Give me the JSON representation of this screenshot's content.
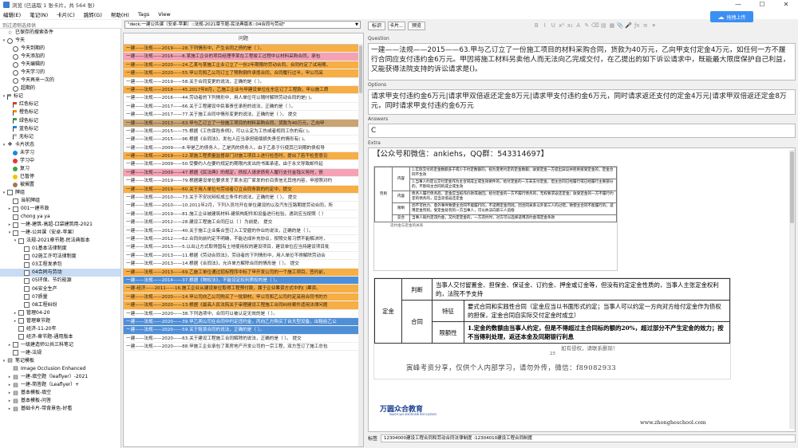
{
  "window": {
    "title": "浏览 (已选取 1 张卡片，共 564 张)",
    "minimize": "—",
    "maximize": "☐",
    "close": "✕"
  },
  "menu": [
    "编辑(E)",
    "笔记(N)",
    "卡片(C)",
    "跳转(G)",
    "帮助(H)",
    "Tags",
    "View"
  ],
  "cloud_button": "拖拽上传",
  "sidebar": {
    "filter_placeholder": "到过滤侧选择供",
    "items": [
      {
        "label": "已保存的搜索条件",
        "icon": "star-icon",
        "indent": 0,
        "exp": ""
      },
      {
        "label": "今天",
        "icon": "clock-icon",
        "indent": 0,
        "exp": "v"
      },
      {
        "label": "今天到期的",
        "icon": "clock-icon",
        "indent": 1,
        "exp": ""
      },
      {
        "label": "今天添加的",
        "icon": "clock-icon",
        "indent": 1,
        "exp": ""
      },
      {
        "label": "今天编辑的",
        "icon": "clock-icon",
        "indent": 1,
        "exp": ""
      },
      {
        "label": "今天学习的",
        "icon": "clock-icon",
        "indent": 1,
        "exp": ""
      },
      {
        "label": "今天再来一次的",
        "icon": "clock-icon",
        "indent": 1,
        "exp": ""
      },
      {
        "label": "超期的",
        "icon": "clock-icon",
        "indent": 1,
        "exp": ""
      },
      {
        "label": "标记",
        "icon": "flag-icon",
        "indent": 0,
        "exp": "v",
        "color": "#888"
      },
      {
        "label": "红色标记",
        "icon": "flag-icon",
        "indent": 1,
        "exp": "",
        "color": "#e53935"
      },
      {
        "label": "橙色标记",
        "icon": "flag-icon",
        "indent": 1,
        "exp": "",
        "color": "#fb8c00"
      },
      {
        "label": "绿色标记",
        "icon": "flag-icon",
        "indent": 1,
        "exp": "",
        "color": "#43a047"
      },
      {
        "label": "蓝色标记",
        "icon": "flag-icon",
        "indent": 1,
        "exp": "",
        "color": "#1e88e5"
      },
      {
        "label": "无标记",
        "icon": "flag-icon",
        "indent": 1,
        "exp": "",
        "color": "#bbb"
      },
      {
        "label": "卡片状态",
        "icon": "status-icon",
        "indent": 0,
        "exp": "v"
      },
      {
        "label": "未学习",
        "icon": "dot-icon",
        "indent": 1,
        "exp": "",
        "color": "#1e88e5"
      },
      {
        "label": "学习中",
        "icon": "dot-icon",
        "indent": 1,
        "exp": "",
        "color": "#e53935"
      },
      {
        "label": "复习",
        "icon": "dot-icon",
        "indent": 1,
        "exp": "",
        "color": "#43a047"
      },
      {
        "label": "已暂停",
        "icon": "dot-icon",
        "indent": 1,
        "exp": "",
        "color": "#f6c200"
      },
      {
        "label": "被搁置",
        "icon": "dot-icon",
        "indent": 1,
        "exp": "",
        "color": "#9e7b4f"
      },
      {
        "label": "牌组",
        "icon": "deck-icon",
        "indent": 0,
        "exp": "v"
      },
      {
        "label": "当前牌组",
        "icon": "deck-icon",
        "indent": 1,
        "exp": ""
      },
      {
        "label": "001一建市政",
        "icon": "deck-icon",
        "indent": 1,
        "exp": ">"
      },
      {
        "label": "chong ya ya",
        "icon": "deck-icon",
        "indent": 1,
        "exp": ""
      },
      {
        "label": "一建-建筑-高超-口袋建筑用-2021",
        "icon": "deck-icon",
        "indent": 1,
        "exp": ">"
      },
      {
        "label": "一建-公共课（安卓-苹果）",
        "icon": "deck-icon",
        "indent": 1,
        "exp": "v"
      },
      {
        "label": "法规-2021章节题-民法典版本",
        "icon": "deck-icon",
        "indent": 2,
        "exp": "v"
      },
      {
        "label": "01基本法律制度",
        "icon": "deck-icon",
        "indent": 3,
        "exp": ""
      },
      {
        "label": "02施工许可法律制度",
        "icon": "deck-icon",
        "indent": 3,
        "exp": ""
      },
      {
        "label": "03工程发承包",
        "icon": "deck-icon",
        "indent": 3,
        "exp": ""
      },
      {
        "label": "04合同与劳动",
        "icon": "deck-icon",
        "indent": 3,
        "exp": "",
        "sel": true
      },
      {
        "label": "05环保、节约能源",
        "icon": "deck-icon",
        "indent": 3,
        "exp": ""
      },
      {
        "label": "06安全生产",
        "icon": "deck-icon",
        "indent": 3,
        "exp": ""
      },
      {
        "label": "07质量",
        "icon": "deck-icon",
        "indent": 3,
        "exp": ""
      },
      {
        "label": "08工程纠纷",
        "icon": "deck-icon",
        "indent": 3,
        "exp": ""
      },
      {
        "label": "管理04-20",
        "icon": "deck-icon",
        "indent": 2,
        "exp": ">"
      },
      {
        "label": "管理章节题",
        "icon": "deck-icon",
        "indent": 2,
        "exp": ">"
      },
      {
        "label": "经济-11-20年",
        "icon": "deck-icon",
        "indent": 2,
        "exp": ""
      },
      {
        "label": "经济-章节题-通用版本",
        "icon": "deck-icon",
        "indent": 2,
        "exp": ""
      },
      {
        "label": "一级建造师公共三科笔记",
        "icon": "deck-icon",
        "indent": 1,
        "exp": ">"
      },
      {
        "label": "一建-法规",
        "icon": "deck-icon",
        "indent": 1,
        "exp": ""
      },
      {
        "label": "笔记模板",
        "icon": "note-icon",
        "indent": 0,
        "exp": "v"
      },
      {
        "label": "Image Occlusion Enhanced",
        "icon": "note-icon",
        "indent": 1,
        "exp": ""
      },
      {
        "label": "一建-填空题（leaflyer）-2021",
        "icon": "note-icon",
        "indent": 1,
        "exp": ">"
      },
      {
        "label": "一建-简答题（Leaflyer）+",
        "icon": "note-icon",
        "indent": 1,
        "exp": ">"
      },
      {
        "label": "基本模板-填空",
        "icon": "note-icon",
        "indent": 1,
        "exp": ">"
      },
      {
        "label": "基本模板-问答",
        "icon": "note-icon",
        "indent": 1,
        "exp": ">"
      },
      {
        "label": "基础卡片-带背景色-好看",
        "icon": "note-icon",
        "indent": 1,
        "exp": ">"
      }
    ]
  },
  "search": {
    "value": "\"deck:一建公共课（安卓-苹果）::法规-2021章节题-民法典版本::04合同与劳动\""
  },
  "toolbar": {
    "fields_btn": "标识",
    "cards_btn": "卡片...",
    "preview_btn": "预览"
  },
  "format_icons": [
    "B",
    "I",
    "U",
    "x²",
    "x₂",
    "A",
    "✎",
    "⌫",
    "▤",
    "▦",
    "📎",
    "🎤",
    "ƒx",
    "≡",
    "▾"
  ],
  "table": {
    "column": "问题",
    "rows": [
      {
        "text": "一建——法规——2019——28.下列情形中，产生合同之债的是（  ）。",
        "c": "o"
      },
      {
        "text": "一建——法规——2016——8.某施工企业的项目经理李某在工程竣工过程中以材料采购合同，承包",
        "c": "p"
      },
      {
        "text": "一建——法规——2020——24.乙某与某施工企业订立了一份2年期限的劳动合同，合同约定了试用期，",
        "c": "o"
      },
      {
        "text": "一建——法规——2020——55.甲公司和乙公司订立了预购钢件承揽合同，合同履行过半，甲公司采",
        "c": "o"
      },
      {
        "text": "一建——法规——2019——58.关于合同变更的说法，正确的是（  ）。",
        "c": "w"
      },
      {
        "text": "一建——法规——2018——45.2017年8月，乙施工企业与甲建设单位在东区订了工程款，甲以施工质",
        "c": "o"
      },
      {
        "text": "一建——法规——2016——44.劳动者的下列情形中，用人单位可以随时解除劳动合同的是(  )。",
        "c": "w"
      },
      {
        "text": "一建——法规——2017——66.关于工程建设中民事责任承担的说法，正确的是（  ）。",
        "c": "w"
      },
      {
        "text": "一建——法规——2017——77.关于施工合同中情形变更的说法，正确的是（  ）。  提交",
        "c": "w"
      },
      {
        "text": "一建——法规——2013——63.甲与乙订立了一份施工项目的材料采购合同，货款为40万元，乙向甲",
        "c": "s"
      },
      {
        "text": "一建——法规——2015——75.根据《工伤保险条例》，可以认定为工伤或者视同工伤的有(  )。",
        "c": "w"
      },
      {
        "text": "一建——法规——2015——96.根据《合同法》，发包人应当承担赔偿损失责任的情形有(  )。",
        "c": "w"
      },
      {
        "text": "一建——法规——2009——8.甲是乙的债务人，乙是丙的债务人，由于乙息于行使其已到期的债权导",
        "c": "w"
      },
      {
        "text": "一建——法规——2019——12.某施工程质量监督部门对施工项目上进行检查时，提出了若干检查意见",
        "c": "o"
      },
      {
        "text": "一建——法规——2009——50.受要约人在要约规定的期限内发出的书面承诺，由于永文导致邮件延",
        "c": "w"
      },
      {
        "text": "一建——法规——2009——47.根据《民法典》的规定，债权人请求债务人履行支付金钱义务时，债",
        "c": "p"
      },
      {
        "text": "一建——法规——2019——79.根据建设单位要求发了某水泥厂家发的价目表信无其他内容，甲按照对约",
        "c": "w"
      },
      {
        "text": "一建——法规——2019——60.关于用人单位与劳动者订立合同条款的约定中，提交",
        "c": "o"
      },
      {
        "text": "一建——法规——2010——73.关于不安抗辩权成立条件的说法，正确的是（  ）。  提交",
        "c": "w"
      },
      {
        "text": "一建——法规——2010——10.2011年2月，下列人员均开在单位建设的以及汽车压路期提劳动合同，所",
        "c": "w"
      },
      {
        "text": "一建——法规——2019——81.施工企业被建筑材料-建筑构配件和设备进行检验，遇到应当按照（  ）",
        "c": "w"
      },
      {
        "text": "一建——法规——2012——28.建设工程施工合同应以（  ）为前提。  提交",
        "c": "w"
      },
      {
        "text": "一建——法规——2012——40.关于施工企业集合签订入工受雇的作业的说法，正确的是（  ）。",
        "c": "w"
      },
      {
        "text": "一建——法规——2012——62.合同向前约定不明确，不能达成补充协议，按照交易习惯不能解决时，",
        "c": "w"
      },
      {
        "text": "一建——法规——2013——5.以出让方式取得国有土地使用权的建设项目，建设单位应当持建设项目批",
        "c": "w"
      },
      {
        "text": "一建——法规——2013——11.根据《劳动合同法》，劳动者的下列情形中，用人单位不得解除劳动合",
        "c": "w"
      },
      {
        "text": "一建——法规——2013——14.根据《合同法》，允许单方解除合同的情形是（  ）。  提交",
        "c": "w"
      },
      {
        "text": "一建——法规——2013——69.乙施工单位通过招标程序中标了甲开发公司的一个施工项目，签约前，",
        "c": "o"
      },
      {
        "text": "一建——法规——2014——37.根据《物权法》，不能设定权利质权的是（  ）。",
        "c": "b"
      },
      {
        "text": "一建-经济——2011——16.施工企业从建设单位取得工程预付款，属于企业筹资方式中的(  )筹资。",
        "c": "o"
      },
      {
        "text": "一建——法规——2020——14.甲公司向乙公司购买了一批钢材，甲公司和乙公司约定采用合同书的方",
        "c": "o"
      },
      {
        "text": "一建——法规——2020——13.根据《最高人民法院关于审理建设工程施工合同纠纷案件适用法律问题",
        "c": "o"
      },
      {
        "text": "一建——法规——2020——38.下列选项中，合同可以被认定无效的是（  ）。",
        "c": "w"
      },
      {
        "text": "一建——法规——2020——39.甲乙两公司在合同中约定违约金，丙向乙方购买了台大型设备，出租给乙公",
        "c": "b"
      },
      {
        "text": "一建——法规——2020——59.关于租赁合同的说法，正确的是（  ）。",
        "c": "b"
      },
      {
        "text": "一建——法规——2020——63.关于建设工程施工合同解除的说法，正确的是（  ）。  提交",
        "c": "w"
      },
      {
        "text": "一建——法规——2020——88.甲施工企业承包了某房地产开发公司的一宗工程，双方签订了施工总包",
        "c": "w"
      }
    ]
  },
  "fields": {
    "question_label": "Question",
    "question": "一建——法规——2015——63.甲与乙订立了一份施工项目的材料采购合同，货款为40万元，乙向甲支付定金4万元，如任何一方不履行合同应支付违约金6万元。甲因将施工材料另卖他人而无法向乙完成交付，在乙提出的如下诉讼请求中，既能最大限度保护自己利益，又能获得法院支持的诉讼请求是()。",
    "options_label": "Options",
    "options": "请求甲支付违约金6万元|请求甲双倍返还定金8万元|请求甲支付违约金6万元，同时请求返还支付的定金4万元|请求甲双倍返还定金8万元，同时请求甲支付违约金6万元",
    "answers_label": "Answers",
    "answer": "C",
    "extra_label": "Extra",
    "extra_contact": "【公众号和微信：ankiehs，QQ群：543314697】",
    "tags_label": "标签",
    "tags": "12304000建设工程合同和劳动合同法律制度 :12304010建设工程合同制度"
  },
  "extra_small": {
    "r1": "2.实际交付的定金数额多于或少于约定数额的，视为变更约定的定金数额；收受定金一方提出异议并拒绝接受定金的，定金合同不生效",
    "r2": "3.当事人约定以交付定金作为主合同成立或生效要件的，给付定金的一方未支付定金，但主合同已经履行或已经履行主要部分的，不影响主合同的成立或生效",
    "r3": "债务人履行债务后，定金应当抵作价款或收回。给付定金的一方不履行债务的，无权要求返还定金；收受定金的一方不履行约定的债务的，应当双倍返还定金",
    "c_neirong": "内容",
    "c_zhangguan": "罚则",
    "c_xianzhi": "限制",
    "r4": "因不可抗力、意外事件致使主合同不能履行的，不适用定金罚则。因合同关系以外第三人的过错，致使主合同不能履行的，适用定金罚则。受定金处罚的一方当事人，可以依法向第三人追偿",
    "c_jieji": "竞合",
    "r5": "当事人既约定违约金，又约定定金的，一方违约时，对方可以选择适用违约金或定金条款",
    "foot": "违约金与定金的关系"
  },
  "extra_table": {
    "dingjin": "定金",
    "panduan": "判断",
    "panduan_text": "当事人交付留置金、担保金、保证金、订约金、押金或订金等，但没有约定定金性质的，当事人主张定金权利的，法院不予支持",
    "hetong": "合同",
    "tezheng": "特征",
    "tezheng_text": "要式合同和实践性合同（定金应当以书面形式约定；当事人可以约定一方向对方给付定金作为债权的担保，定金合同自实际交付定金时成立）",
    "xianexing": "限额性",
    "xianexing_text": "1.定金的数额由当事人约定，但是不得超过主合同标的额的20%，超过部分不产生定金的效力；按不当得利处理，返还本金及同期银行利息",
    "watermark1": "如有侵权，请联系删除！",
    "page_no": "25",
    "watermark2": "寅峰考资分享，仅供个人内部学习，请勿外传，微信：f89082933",
    "brand": "万圆众合教育",
    "brand_sub": "WANYUAN ZHONGHE EDUCATION",
    "website": "www.zhongheschool.com"
  }
}
